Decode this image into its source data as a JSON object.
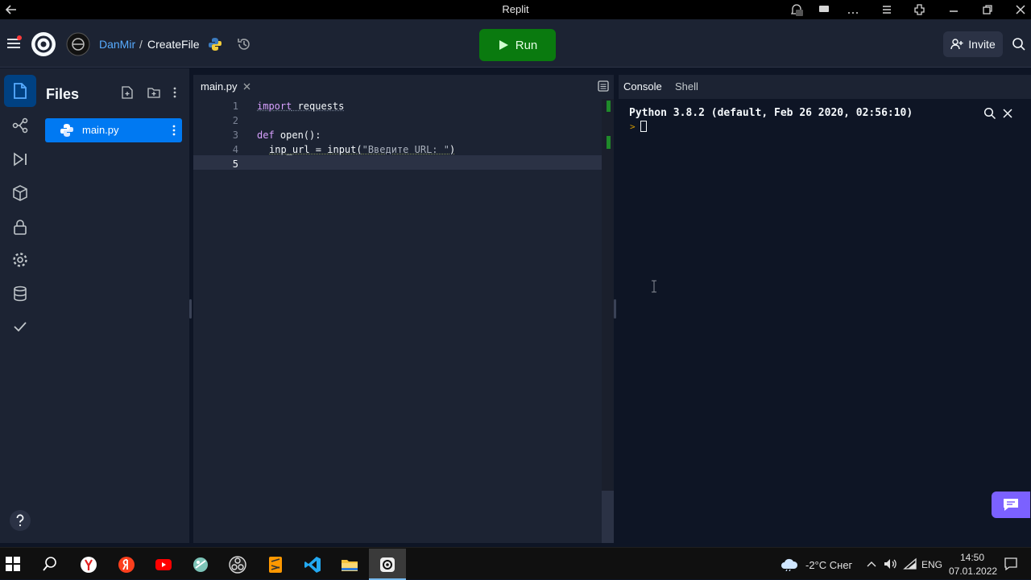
{
  "window": {
    "title": "Replit"
  },
  "header": {
    "user": "DanMir",
    "separator": "/",
    "project": "CreateFile",
    "run_label": "Run",
    "invite_label": "Invite"
  },
  "files": {
    "heading": "Files",
    "items": [
      {
        "name": "main.py"
      }
    ]
  },
  "editor": {
    "tab": "main.py",
    "line_numbers": [
      "1",
      "2",
      "3",
      "4",
      "5"
    ],
    "code": {
      "l1_kw": "import",
      "l1_rest": " requests",
      "l3_kw": "def",
      "l3_rest": " open():",
      "l4_a": "inp_url = input(",
      "l4_str": "\"Введите URL: \"",
      "l4_b": ")"
    }
  },
  "console": {
    "tab_console": "Console",
    "tab_shell": "Shell",
    "banner": "Python 3.8.2 (default, Feb 26 2020, 02:56:10)",
    "prompt": ">"
  },
  "taskbar": {
    "weather": "-2°C Снег",
    "lang": "ENG",
    "time": "14:50",
    "date": "07.01.2022"
  },
  "colors": {
    "accent": "#0079f2",
    "run": "#0a7a0f",
    "bg": "#0e1525",
    "panel": "#1c2333"
  },
  "icons": [
    "back-icon",
    "notification-icon",
    "chat-icon",
    "more-icon",
    "menu-icon",
    "extension-icon",
    "minimize-icon",
    "restore-icon",
    "close-icon",
    "hamburger-icon",
    "replit-logo",
    "avatar",
    "python-icon",
    "history-icon",
    "play-icon",
    "invite-icon",
    "search-icon",
    "files-icon",
    "git-icon",
    "debugger-icon",
    "packages-icon",
    "secrets-icon",
    "settings-icon",
    "database-icon",
    "check-icon",
    "help-icon",
    "new-file-icon",
    "new-folder-icon",
    "kebab-icon",
    "layout-icon",
    "feedback-chat-icon",
    "windows-start-icon",
    "taskbar-search-icon",
    "yandex-browser-icon",
    "yandex-icon",
    "youtube-icon",
    "app-icon",
    "obs-icon",
    "sublime-icon",
    "vscode-icon",
    "explorer-icon",
    "active-app-icon",
    "weather-icon",
    "volume-icon",
    "wifi-icon",
    "action-center-icon"
  ]
}
